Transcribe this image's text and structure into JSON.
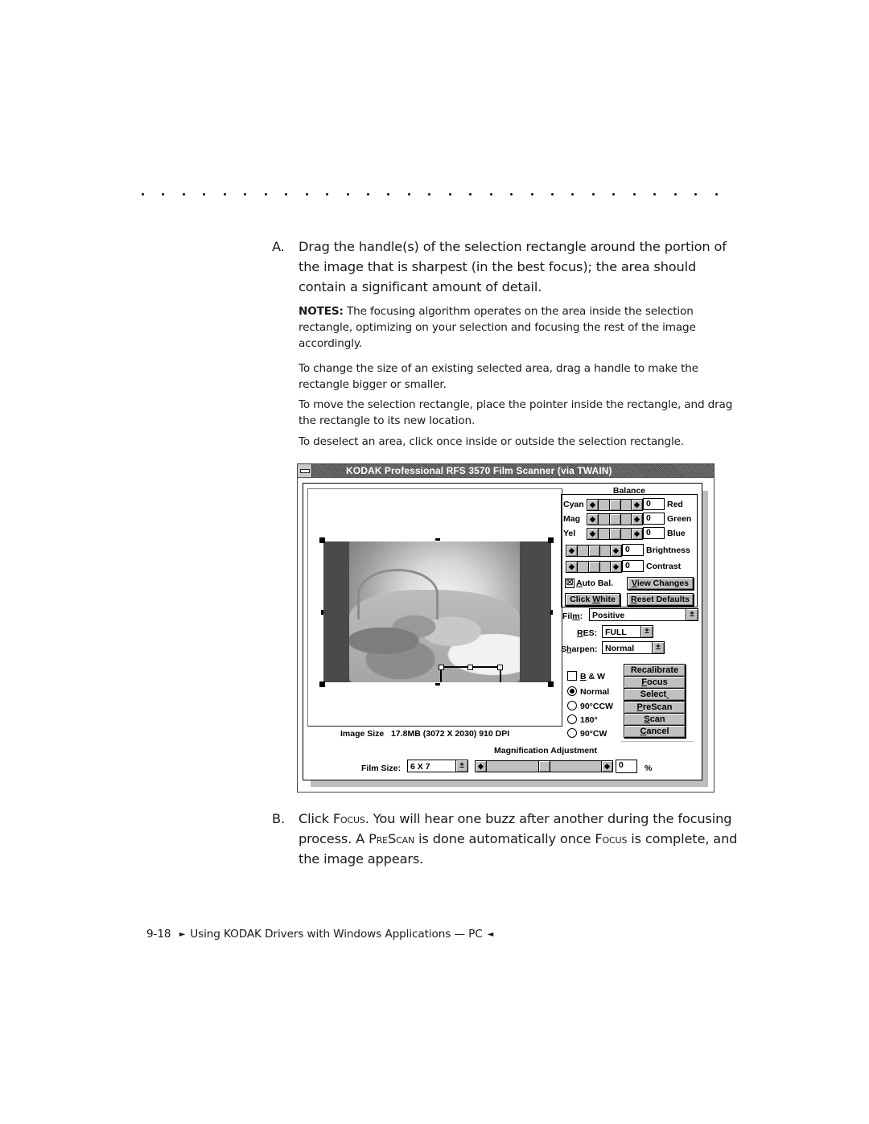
{
  "page": {
    "separator_dot_count": 29,
    "step_a": {
      "letter": "A.",
      "text": "Drag the handle(s) of the selection rectangle around the portion of the image that is sharpest (in the best focus); the area should contain a significant amount of detail."
    },
    "notes": [
      {
        "label": "NOTES:",
        "text": " The focusing algorithm operates on the area inside the selection rectangle, optimizing on your selection and focusing the rest of the image accordingly."
      },
      {
        "label": "",
        "text": "To change the size of an existing selected area, drag a handle to make the rectangle bigger or smaller."
      },
      {
        "label": "",
        "text": "To move the selection rectangle, place the pointer inside the rectangle, and drag the rectangle to its new location."
      },
      {
        "label": "",
        "text": "To deselect an area, click once inside or outside the selection rectangle."
      }
    ],
    "step_b": {
      "letter": "B.",
      "part1": "Click ",
      "focus1": "Focus",
      "part2": ". You will hear one buzz after another during the focusing process. A ",
      "prescan": "PreScan",
      "part3": " is done automatically once ",
      "focus2": "Focus",
      "part4": " is complete, and the image appears."
    },
    "footer": {
      "page_number": "9-18",
      "left_marker": "►",
      "title": "Using KODAK Drivers with Windows Applications — PC",
      "right_marker": "◄"
    }
  },
  "dialog": {
    "title": "KODAK Professional RFS 3570 Film Scanner (via TWAIN)",
    "system_menu_icon": "minus-bar",
    "image_size_label": "Image Size",
    "image_size_value": "17.8MB (3072 X 2030) 910 DPI",
    "balance": {
      "title": "Balance",
      "rows": [
        {
          "left": "Cyan",
          "right": "Red",
          "value": "0",
          "slider_fraction": 0.5
        },
        {
          "left": "Mag",
          "right": "Green",
          "value": "0",
          "slider_fraction": 0.5
        },
        {
          "left": "Yel",
          "right": "Blue",
          "value": "0",
          "slider_fraction": 0.5
        }
      ],
      "brightness": {
        "label": "Brightness",
        "value": "0",
        "slider_fraction": 0.5
      },
      "contrast": {
        "label": "Contrast",
        "value": "0",
        "slider_fraction": 0.5
      },
      "auto_bal": {
        "label": "Auto Bal.",
        "checked": true
      },
      "view_changes": "View Changes",
      "click_white": "Click White",
      "reset_defaults": "Reset Defaults"
    },
    "film": {
      "label": "Film:",
      "value": "Positive"
    },
    "res": {
      "label": "RES:",
      "value": "FULL"
    },
    "sharpen": {
      "label": "Sharpen:",
      "value": "Normal"
    },
    "bw": {
      "label": "B & W",
      "checked": false
    },
    "orientation": {
      "options": [
        "Normal",
        "90°CCW",
        "180°",
        "90°CW"
      ],
      "selected": "Normal"
    },
    "buttons": {
      "recalibrate": "Recalibrate",
      "focus": "Focus",
      "select": "Select",
      "prescan": "PreScan",
      "scan": "Scan",
      "cancel": "Cancel"
    },
    "magnification": {
      "title": "Magnification Adjustment",
      "value": "0",
      "unit": "%",
      "slider_fraction": 0.5
    },
    "film_size": {
      "label": "Film Size:",
      "value": "6 X 7"
    },
    "arrows": {
      "left": "◆",
      "right": "◆",
      "dropdown": "±"
    }
  }
}
